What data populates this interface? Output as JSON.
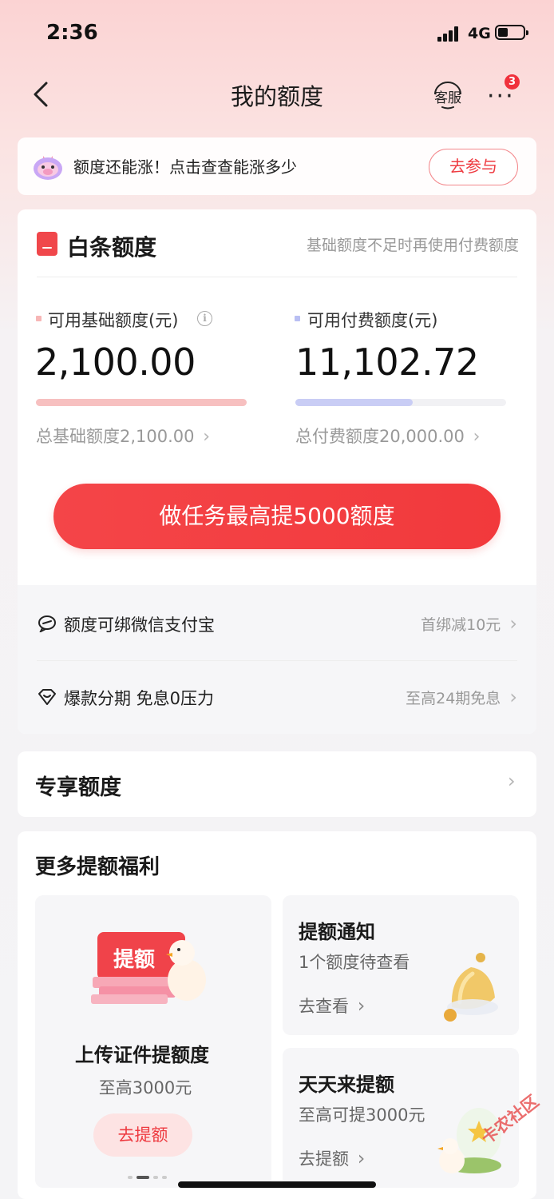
{
  "status_bar": {
    "time": "2:36",
    "network": "4G"
  },
  "nav": {
    "title": "我的额度",
    "service_label": "客服",
    "more_badge": "3"
  },
  "promo": {
    "text": "额度还能涨！点击查查能涨多少",
    "button": "去参与"
  },
  "credit_card": {
    "title": "白条额度",
    "hint": "基础额度不足时再使用付费额度",
    "basic": {
      "label": "可用基础额度(元)",
      "amount": "2,100.00",
      "total": "总基础额度2,100.00",
      "fill_fraction": 1.0,
      "color": "#f7c0c0"
    },
    "paid": {
      "label": "可用付费额度(元)",
      "amount": "11,102.72",
      "total": "总付费额度20,000.00",
      "fill_fraction": 0.555,
      "color": "#c9cdf5"
    },
    "cta": "做任务最高提5000额度",
    "rows": [
      {
        "text": "额度可绑微信支付宝",
        "right": "首绑减10元"
      },
      {
        "text": "爆款分期 免息0压力",
        "right": "至高24期免息"
      }
    ]
  },
  "exclusive": {
    "title": "专享额度"
  },
  "benefits": {
    "title": "更多提额福利",
    "upload": {
      "badge": "提额",
      "title": "上传证件提额度",
      "sub": "至高3000元",
      "button": "去提额"
    },
    "notify": {
      "title": "提额通知",
      "sub": "1个额度待查看",
      "link": "去查看"
    },
    "daily": {
      "title": "天天来提额",
      "sub": "至高可提3000元",
      "link": "去提额"
    }
  },
  "watermark": "卡农社区",
  "colors": {
    "accent": "#f2393c",
    "badge": "#f0313c"
  }
}
